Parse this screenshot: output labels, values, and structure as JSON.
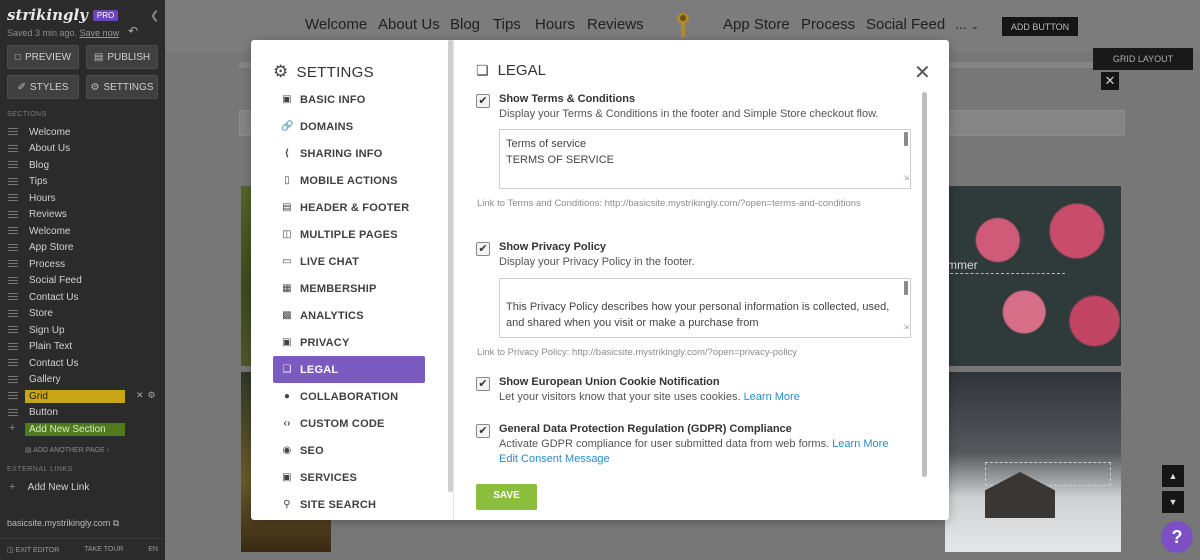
{
  "editor": {
    "logo": "strikingly",
    "pro_badge": "PRO",
    "saved_text": "Saved 3 min ago.",
    "save_now": "Save now",
    "preview_label": "PREVIEW",
    "publish_label": "PUBLISH",
    "styles_label": "STYLES",
    "settings_label": "SETTINGS",
    "sections_heading": "SECTIONS",
    "sections": [
      "Welcome",
      "About Us",
      "Blog",
      "Tips",
      "Hours",
      "Reviews",
      "Welcome",
      "App Store",
      "Process",
      "Social Feed",
      "Contact Us",
      "Store",
      "Sign Up",
      "Plain Text",
      "Contact Us",
      "Gallery",
      "Grid",
      "Button"
    ],
    "active_section_index": 16,
    "add_section": "Add New Section",
    "add_page": "ADD ANOTHER PAGE",
    "external_heading": "EXTERNAL LINKS",
    "add_link": "Add New Link",
    "site_url": "basicsite.mystrikingly.com",
    "exit_editor": "EXIT EDITOR",
    "take_tour": "TAKE TOUR",
    "lang": "EN"
  },
  "site": {
    "nav_left": [
      "Welcome",
      "About Us",
      "Blog",
      "Tips",
      "Hours",
      "Reviews"
    ],
    "nav_right": [
      "App Store",
      "Process",
      "Social Feed"
    ],
    "nav_more": "...",
    "add_button": "ADD BUTTON",
    "grid_layout": "GRID LAYOUT",
    "roses_text": "mmer"
  },
  "settings": {
    "title": "SETTINGS",
    "menu": [
      {
        "label": "BASIC INFO",
        "icon": "briefcase-icon"
      },
      {
        "label": "DOMAINS",
        "icon": "link-icon"
      },
      {
        "label": "SHARING INFO",
        "icon": "share-icon"
      },
      {
        "label": "MOBILE ACTIONS",
        "icon": "mobile-icon"
      },
      {
        "label": "HEADER & FOOTER",
        "icon": "header-footer-icon"
      },
      {
        "label": "MULTIPLE PAGES",
        "icon": "pages-icon"
      },
      {
        "label": "LIVE CHAT",
        "icon": "chat-icon"
      },
      {
        "label": "MEMBERSHIP",
        "icon": "membership-icon"
      },
      {
        "label": "ANALYTICS",
        "icon": "analytics-icon"
      },
      {
        "label": "PRIVACY",
        "icon": "lock-icon"
      },
      {
        "label": "LEGAL",
        "icon": "gavel-icon"
      },
      {
        "label": "COLLABORATION",
        "icon": "users-icon"
      },
      {
        "label": "CUSTOM CODE",
        "icon": "code-icon"
      },
      {
        "label": "SEO",
        "icon": "seo-icon"
      },
      {
        "label": "SERVICES",
        "icon": "services-icon"
      },
      {
        "label": "SITE SEARCH",
        "icon": "search-icon"
      }
    ],
    "active_index": 10,
    "accent": "#7b5bbf"
  },
  "legal": {
    "title": "LEGAL",
    "terms": {
      "checked": true,
      "title": "Show Terms & Conditions",
      "desc": "Display your Terms & Conditions in the footer and Simple Store checkout flow.",
      "text_line1": "Terms of service",
      "text_line2": "TERMS OF SERVICE",
      "link_note": "Link to Terms and Conditions: http://basicsite.mystrikingly.com/?open=terms-and-conditions"
    },
    "privacy": {
      "checked": true,
      "title": "Show Privacy Policy",
      "desc": "Display your Privacy Policy in the footer.",
      "text_line1": "This Privacy Policy describes how your personal information is collected, used,",
      "text_line2": "and shared when you visit or make a purchase from",
      "link_note": "Link to Privacy Policy: http://basicsite.mystrikingly.com/?open=privacy-policy"
    },
    "cookie": {
      "checked": true,
      "title": "Show European Union Cookie Notification",
      "desc": "Let your visitors know that your site uses cookies.",
      "learn_more": "Learn More"
    },
    "gdpr": {
      "checked": true,
      "title": "General Data Protection Regulation (GDPR) Compliance",
      "desc": "Activate GDPR compliance for user submitted data from web forms.",
      "learn_more": "Learn More",
      "edit_consent": "Edit Consent Message"
    },
    "save_label": "SAVE"
  }
}
